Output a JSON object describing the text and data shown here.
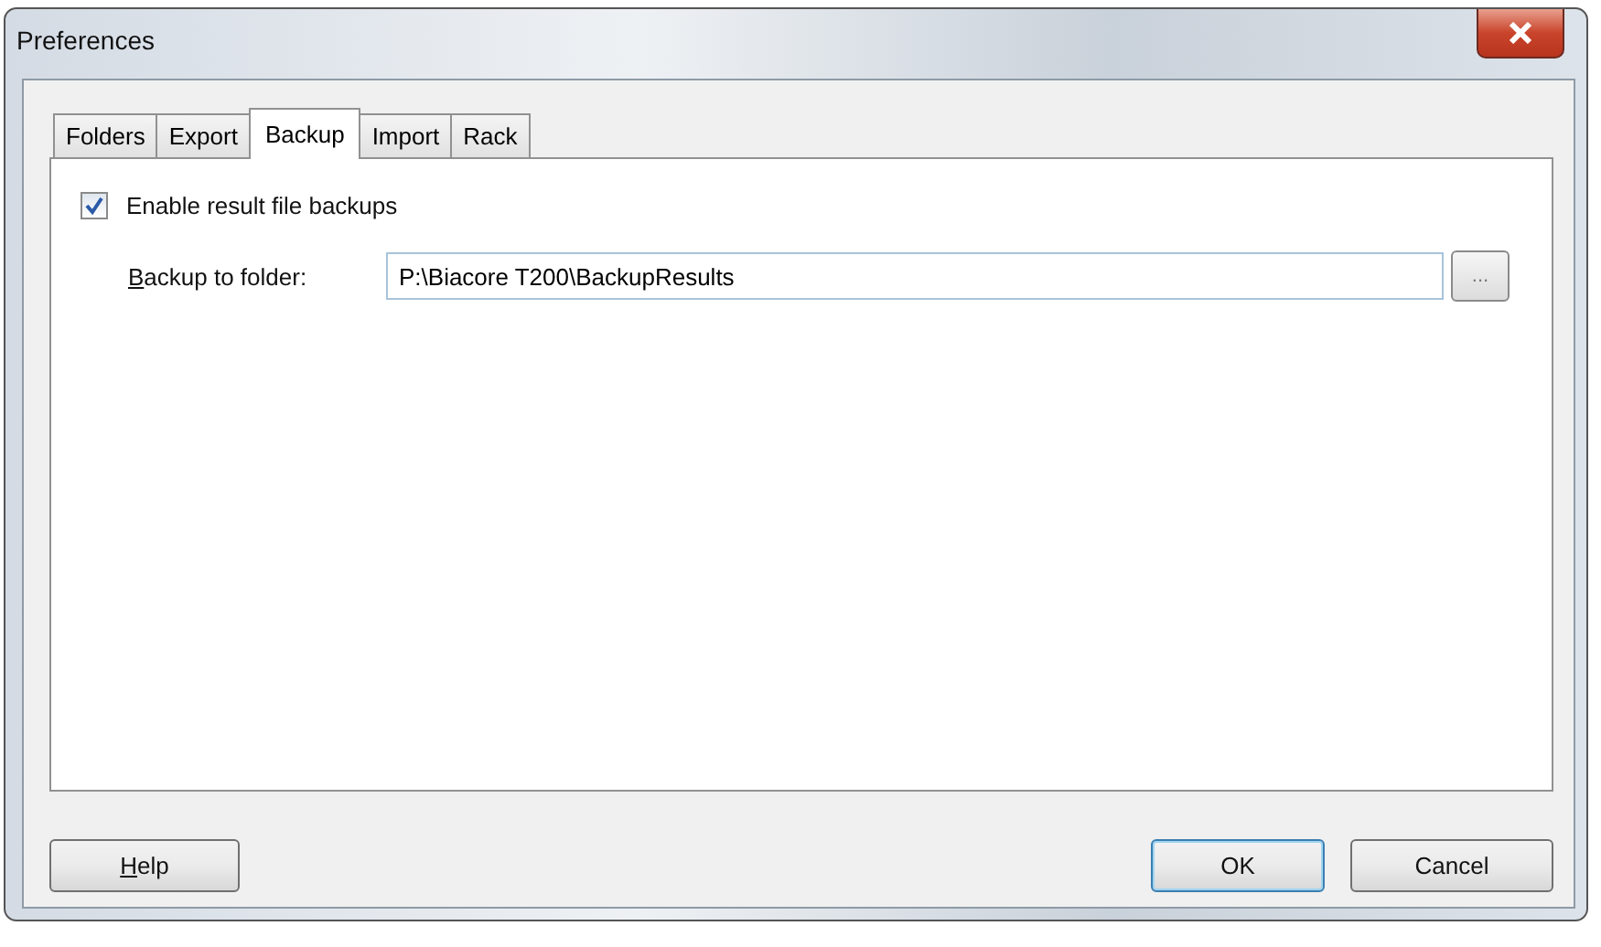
{
  "window": {
    "title": "Preferences"
  },
  "tabs": [
    {
      "label": "Folders",
      "selected": false
    },
    {
      "label": "Export",
      "selected": false
    },
    {
      "label": "Backup",
      "selected": true
    },
    {
      "label": "Import",
      "selected": false
    },
    {
      "label": "Rack",
      "selected": false
    }
  ],
  "backup": {
    "checkbox": {
      "label": "Enable result file backups",
      "checked": true
    },
    "folder": {
      "label": "Backup to folder:",
      "first_letter_underlined": true,
      "value": "P:\\Biacore T200\\BackupResults",
      "browse": "..."
    }
  },
  "buttons": [
    {
      "label": "Help",
      "kind": "left",
      "first_letter_underlined": true
    },
    {
      "label": "OK",
      "kind": "default",
      "first_letter_underlined": false
    },
    {
      "label": "Cancel",
      "kind": "right",
      "first_letter_underlined": false
    }
  ]
}
